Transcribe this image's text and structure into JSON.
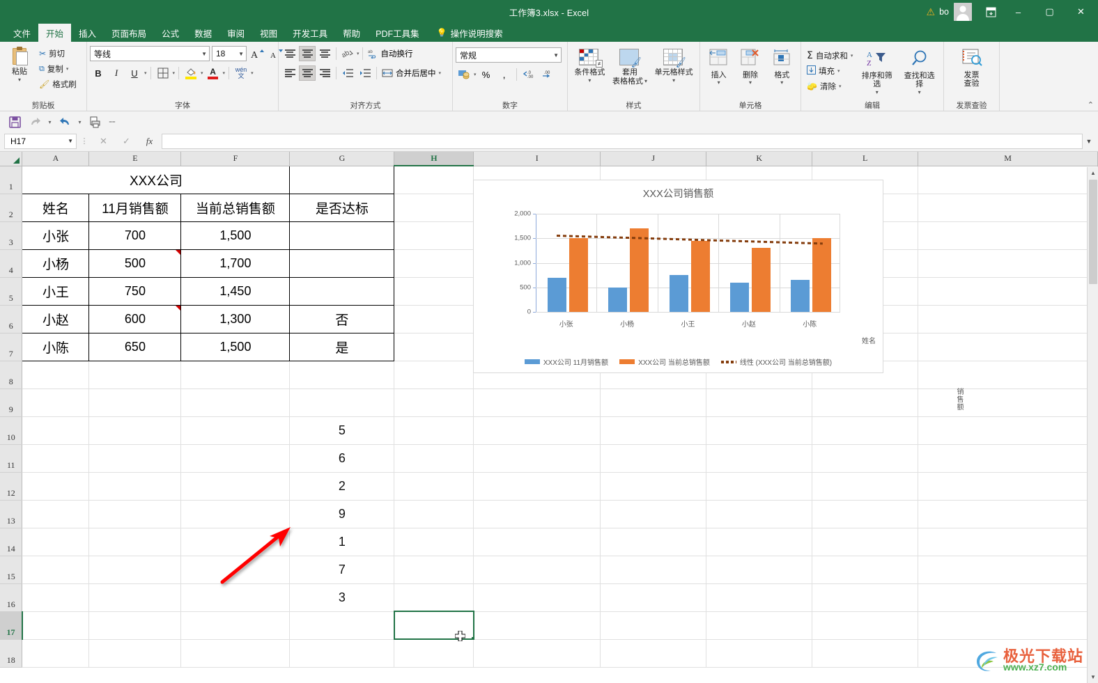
{
  "titlebar": {
    "title": "工作簿3.xlsx  -  Excel",
    "warning_icon": "warning-triangle-icon",
    "user_name": "bo",
    "avatar": "user-avatar",
    "ribbon_display_icon": "ribbon-display-options-icon",
    "minimize": "–",
    "maximize": "▢",
    "close": "✕"
  },
  "tabs": {
    "items": [
      {
        "label": "文件",
        "active": false
      },
      {
        "label": "开始",
        "active": true
      },
      {
        "label": "插入",
        "active": false
      },
      {
        "label": "页面布局",
        "active": false
      },
      {
        "label": "公式",
        "active": false
      },
      {
        "label": "数据",
        "active": false
      },
      {
        "label": "审阅",
        "active": false
      },
      {
        "label": "视图",
        "active": false
      },
      {
        "label": "开发工具",
        "active": false
      },
      {
        "label": "帮助",
        "active": false
      },
      {
        "label": "PDF工具集",
        "active": false
      }
    ],
    "search_label": "操作说明搜索",
    "search_icon": "lightbulb-icon"
  },
  "ribbon": {
    "clipboard": {
      "group_label": "剪贴板",
      "paste": "粘贴",
      "cut": "剪切",
      "copy": "复制",
      "format_painter": "格式刷"
    },
    "font": {
      "group_label": "字体",
      "font_name": "等线",
      "font_size": "18",
      "grow": "A",
      "shrink": "A",
      "bold": "B",
      "italic": "I",
      "underline": "U",
      "borders_icon": "borders-icon",
      "fill_color_icon": "fill-color-icon",
      "font_color_icon": "font-color-icon",
      "phonetic_top": "wén",
      "phonetic_bottom": "文"
    },
    "alignment": {
      "group_label": "对齐方式",
      "orientation_icon": "text-orientation-icon",
      "wrap_text": "自动换行",
      "merge_center": "合并后居中",
      "decrease_indent_icon": "decrease-indent-icon",
      "increase_indent_icon": "increase-indent-icon"
    },
    "number": {
      "group_label": "数字",
      "format": "常规",
      "accounting_icon": "accounting-format-icon",
      "percent": "%",
      "comma": ",",
      "increase_decimal": ".00",
      "decrease_decimal": ".00"
    },
    "styles": {
      "group_label": "样式",
      "conditional": "条件格式",
      "table_format_l1": "套用",
      "table_format_l2": "表格格式",
      "cell_styles": "单元格样式"
    },
    "cells": {
      "group_label": "单元格",
      "insert": "插入",
      "delete": "删除",
      "format": "格式"
    },
    "editing": {
      "group_label": "编辑",
      "autosum": "自动求和",
      "fill": "填充",
      "clear": "清除",
      "sort_filter": "排序和筛选",
      "find_select": "查找和选择"
    },
    "invoice": {
      "group_label": "发票查验",
      "line1": "发票",
      "line2": "查验"
    },
    "collapse_icon": "collapse-ribbon-icon"
  },
  "qat": {
    "save_icon": "save-icon",
    "redo_icon": "redo-icon",
    "undo_icon": "undo-icon",
    "print_preview_icon": "print-preview-icon",
    "customize_icon": "customize-qat-icon"
  },
  "formula_bar": {
    "name_box": "H17",
    "cancel_icon": "cancel-icon",
    "confirm_icon": "confirm-icon",
    "fx_icon": "fx",
    "value": "",
    "expand_icon": "expand-formula-bar-icon"
  },
  "grid": {
    "columns": [
      "A",
      "E",
      "F",
      "G",
      "H",
      "I",
      "J",
      "K",
      "L",
      "M"
    ],
    "selected_column": "H",
    "selected_row": "17",
    "selected_cell": "H17",
    "rows": [
      {
        "n": "1",
        "A": "XXX公司",
        "E": "",
        "F": "",
        "G": ""
      },
      {
        "n": "2",
        "A": "姓名",
        "E": "11月销售额",
        "F": "当前总销售额",
        "G": "是否达标"
      },
      {
        "n": "3",
        "A": "小张",
        "E": "700",
        "F": "1,500",
        "G": ""
      },
      {
        "n": "4",
        "A": "小杨",
        "E": "500",
        "F": "1,700",
        "G": ""
      },
      {
        "n": "5",
        "A": "小王",
        "E": "750",
        "F": "1,450",
        "G": ""
      },
      {
        "n": "6",
        "A": "小赵",
        "E": "600",
        "F": "1,300",
        "G": "否"
      },
      {
        "n": "7",
        "A": "小陈",
        "E": "650",
        "F": "1,500",
        "G": "是"
      },
      {
        "n": "8",
        "A": "",
        "E": "",
        "F": "",
        "G": ""
      },
      {
        "n": "9",
        "A": "",
        "E": "",
        "F": "",
        "G": ""
      },
      {
        "n": "10",
        "A": "",
        "E": "",
        "F": "",
        "G": "5"
      },
      {
        "n": "11",
        "A": "",
        "E": "",
        "F": "",
        "G": "6"
      },
      {
        "n": "12",
        "A": "",
        "E": "",
        "F": "",
        "G": "2"
      },
      {
        "n": "13",
        "A": "",
        "E": "",
        "F": "",
        "G": "9"
      },
      {
        "n": "14",
        "A": "",
        "E": "",
        "F": "",
        "G": "1"
      },
      {
        "n": "15",
        "A": "",
        "E": "",
        "F": "",
        "G": "7"
      },
      {
        "n": "16",
        "A": "",
        "E": "",
        "F": "",
        "G": "3"
      },
      {
        "n": "17",
        "A": "",
        "E": "",
        "F": "",
        "G": ""
      },
      {
        "n": "18",
        "A": "",
        "E": "",
        "F": "",
        "G": ""
      }
    ]
  },
  "chart_data": {
    "type": "bar",
    "title": "XXX公司销售额",
    "xlabel": "姓名",
    "ylabel": "销售额",
    "categories": [
      "小张",
      "小杨",
      "小王",
      "小赵",
      "小陈"
    ],
    "ylim": [
      0,
      2000
    ],
    "yticks": [
      "0",
      "500",
      "1,000",
      "1,500",
      "2,000"
    ],
    "grid": true,
    "legend_position": "bottom",
    "series": [
      {
        "name": "XXX公司 11月销售额",
        "color": "#5B9BD5",
        "values": [
          700,
          500,
          750,
          600,
          650
        ]
      },
      {
        "name": "XXX公司 当前总销售额",
        "color": "#ED7D31",
        "values": [
          1500,
          1700,
          1450,
          1300,
          1500
        ]
      }
    ],
    "trendline": {
      "name": "线性 (XXX公司 当前总销售额)",
      "color": "#843C0C",
      "style": "dotted",
      "start_value": 1570,
      "end_value": 1410
    }
  },
  "annotation": {
    "arrow_color": "#FF0000",
    "arrow_name": "red-pointer-arrow"
  },
  "watermark": {
    "text": "极光下载站",
    "url": "www.xz7.com"
  },
  "scrollbar": {
    "up_icon": "▲",
    "down_icon": "▼"
  }
}
